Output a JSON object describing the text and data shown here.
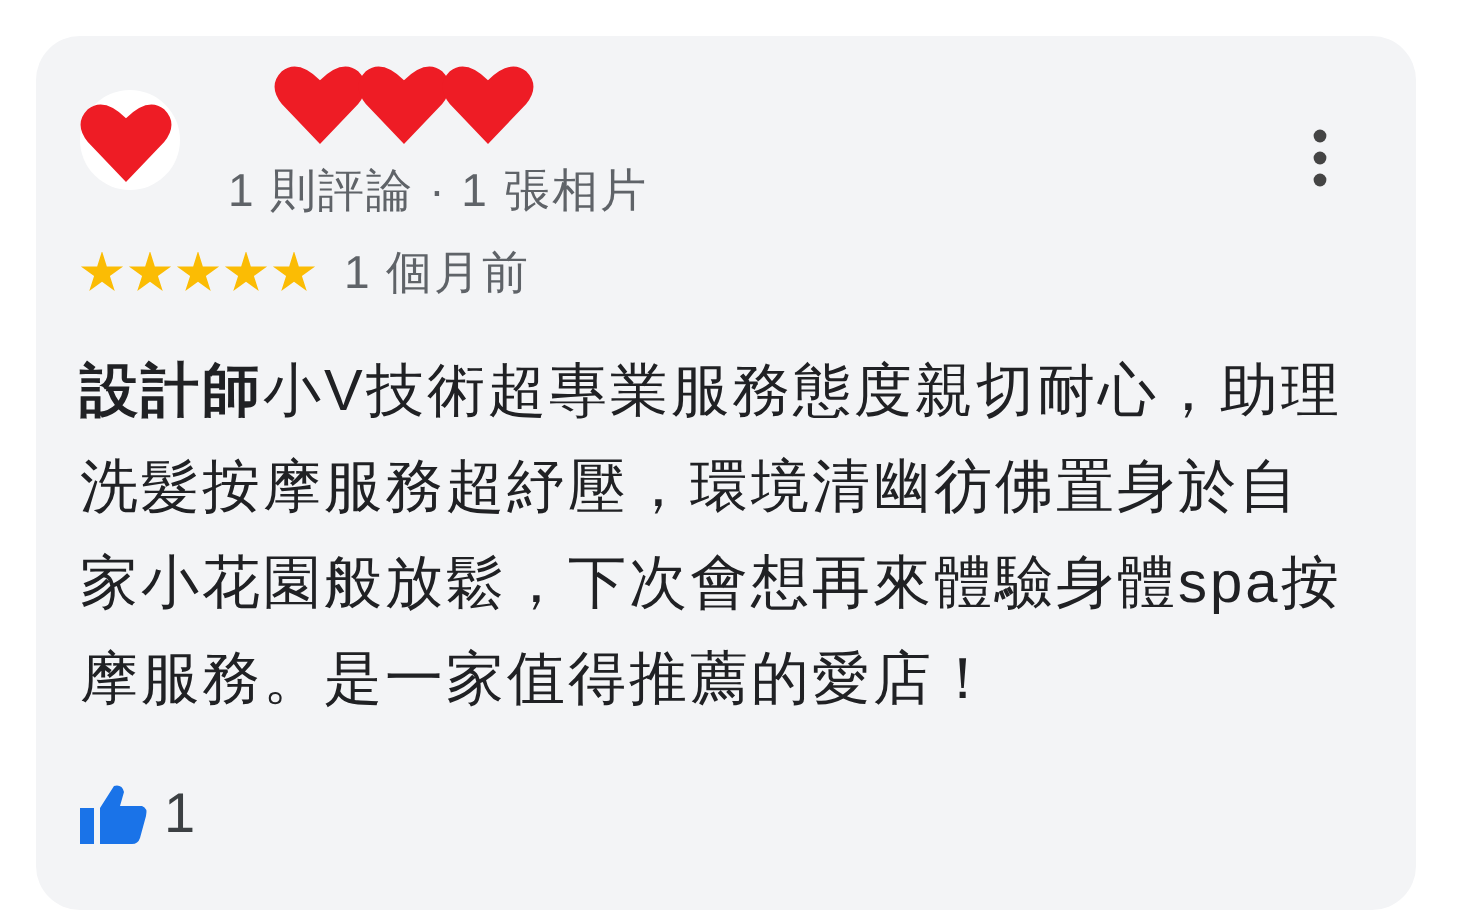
{
  "review": {
    "reviewer_meta": "1 則評論 · 1 張相片",
    "stars": 5,
    "time": "1 個月前",
    "text": "**設計師**小V技術超專業服務態度親切耐心，助理洗髮按摩服務超紓壓，環境清幽彷佛置身於自家小花園般放鬆，下次會想再來體驗身體spa按摩服務。是一家值得推薦的愛店！",
    "likes": "1"
  }
}
